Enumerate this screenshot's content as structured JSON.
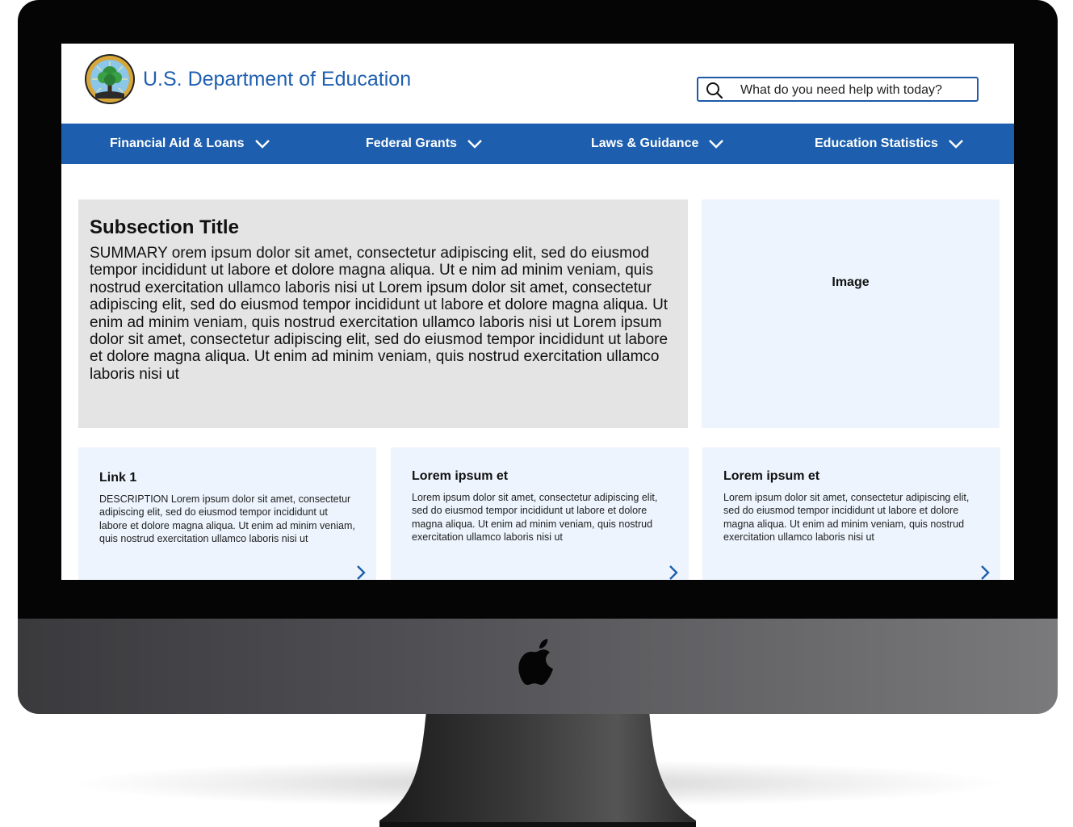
{
  "header": {
    "site_title": "U.S. Department of Education",
    "search": {
      "placeholder": "What do you need help with today?"
    }
  },
  "nav": {
    "items": [
      {
        "label": "Financial Aid & Loans"
      },
      {
        "label": "Federal Grants"
      },
      {
        "label": "Laws & Guidance"
      },
      {
        "label": "Education Statistics"
      }
    ]
  },
  "summary": {
    "title": "Subsection Title",
    "text": "SUMMARY orem ipsum dolor sit amet, consectetur adipiscing elit, sed do eiusmod tempor incididunt ut labore et dolore magna aliqua. Ut e nim ad minim veniam, quis nostrud exercitation ullamco laboris nisi ut Lorem ipsum dolor sit amet, consectetur adipiscing elit, sed do eiusmod tempor incididunt ut labore et dolore magna aliqua. Ut enim ad minim veniam, quis nostrud exercitation ullamco laboris nisi ut Lorem ipsum dolor sit amet, consectetur adipiscing elit, sed do eiusmod tempor incididunt ut labore et dolore magna aliqua. Ut enim ad minim veniam, quis nostrud exercitation ullamco laboris nisi ut"
  },
  "image_placeholder": {
    "label": "Image"
  },
  "cards": [
    {
      "title": "Link 1",
      "description": "DESCRIPTION Lorem ipsum dolor sit amet, consectetur adipiscing elit, sed do eiusmod tempor incididunt ut labore et dolore magna aliqua. Ut enim ad minim veniam, quis nostrud exercitation ullamco laboris nisi ut"
    },
    {
      "title": "Lorem ipsum et",
      "description": "Lorem ipsum dolor sit amet, consectetur adipiscing elit, sed do eiusmod tempor incididunt ut labore et dolore magna aliqua. Ut enim ad minim veniam, quis nostrud exercitation ullamco laboris nisi ut"
    },
    {
      "title": "Lorem ipsum et",
      "description": "Lorem ipsum dolor sit amet, consectetur adipiscing elit, sed do eiusmod tempor incididunt ut labore et dolore magna aliqua. Ut enim ad minim veniam, quis nostrud exercitation ullamco laboris nisi ut"
    }
  ],
  "colors": {
    "brand_blue": "#1d5fae",
    "summary_bg": "#e4e4e4",
    "card_bg": "#edf4fd"
  },
  "icons": {
    "seal": "department-seal-icon",
    "search": "search-icon",
    "nav_chevron": "chevron-down-icon",
    "card_chevron": "chevron-right-icon",
    "device_logo": "apple-logo-icon"
  }
}
